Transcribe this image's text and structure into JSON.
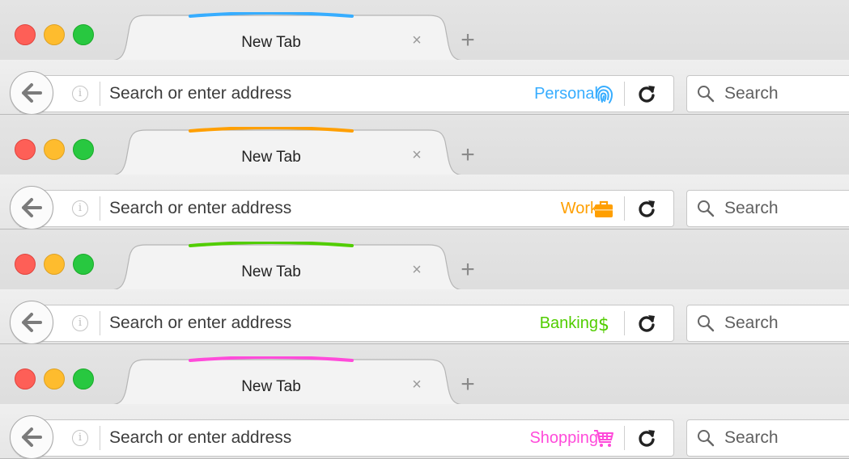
{
  "windows": [
    {
      "tab": {
        "title": "New Tab",
        "close": "×"
      },
      "new_tab": "+",
      "url": {
        "placeholder": "Search or enter address"
      },
      "container": {
        "label": "Personal",
        "icon": "fingerprint-icon",
        "color": "#37ADFF"
      },
      "search": {
        "placeholder": "Search"
      }
    },
    {
      "tab": {
        "title": "New Tab",
        "close": "×"
      },
      "new_tab": "+",
      "url": {
        "placeholder": "Search or enter address"
      },
      "container": {
        "label": "Work",
        "icon": "briefcase-icon",
        "color": "#FF9F00"
      },
      "search": {
        "placeholder": "Search"
      }
    },
    {
      "tab": {
        "title": "New Tab",
        "close": "×"
      },
      "new_tab": "+",
      "url": {
        "placeholder": "Search or enter address"
      },
      "container": {
        "label": "Banking",
        "icon": "dollar-icon",
        "color": "#51CD00"
      },
      "search": {
        "placeholder": "Search"
      }
    },
    {
      "tab": {
        "title": "New Tab",
        "close": "×"
      },
      "new_tab": "+",
      "url": {
        "placeholder": "Search or enter address"
      },
      "container": {
        "label": "Shopping",
        "icon": "cart-icon",
        "color": "#FF4BDA"
      },
      "search": {
        "placeholder": "Search"
      }
    }
  ],
  "ui_colors": {
    "tab_border": "#b5b5b5",
    "tab_fill": "#f3f3f3"
  }
}
